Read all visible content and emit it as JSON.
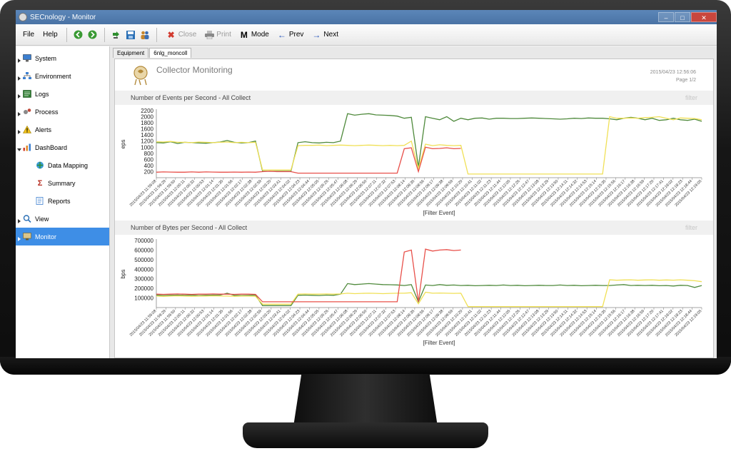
{
  "window": {
    "title": "SECnology - Monitor"
  },
  "menu": [
    {
      "label": "File"
    },
    {
      "label": "Help"
    }
  ],
  "toolbar": {
    "close_label": "Close",
    "print_label": "Print",
    "mode_label": "Mode",
    "prev_label": "Prev",
    "next_label": "Next"
  },
  "sidebar": {
    "items": [
      {
        "label": "System",
        "icon": "computer-icon"
      },
      {
        "label": "Environment",
        "icon": "network-icon"
      },
      {
        "label": "Logs",
        "icon": "logs-icon"
      },
      {
        "label": "Process",
        "icon": "process-icon"
      },
      {
        "label": "Alerts",
        "icon": "alert-icon"
      },
      {
        "label": "DashBoard",
        "icon": "dashboard-icon"
      },
      {
        "label": "Data Mapping",
        "icon": "data-mapping-icon"
      },
      {
        "label": "Summary",
        "icon": "sigma-icon"
      },
      {
        "label": "Reports",
        "icon": "reports-icon"
      },
      {
        "label": "View",
        "icon": "view-icon"
      },
      {
        "label": "Monitor",
        "icon": "monitor-icon"
      }
    ]
  },
  "tabs": [
    {
      "label": "Equipment"
    },
    {
      "label": "6nlg_moncoll"
    }
  ],
  "report": {
    "title": "Collector Monitoring",
    "date": "2015/04/23 12:56:06",
    "page": "Page 1/2"
  },
  "colors": {
    "green": "#4f8a3c",
    "yellow": "#f0e056",
    "red": "#e8504a",
    "accent": "#3e8ee6"
  },
  "chart_data": [
    {
      "type": "line",
      "title": "Number of Events per Second - All Collect",
      "filter_label": "filter",
      "ylabel": "eps",
      "xlabel": "[Filter Event]",
      "ylim": [
        0,
        2200
      ],
      "yticks": [
        200,
        400,
        600,
        800,
        1000,
        1200,
        1400,
        1600,
        1800,
        2000,
        2200
      ],
      "x": [
        "2015/04/23 11:59:08",
        "2015/04/23 11:59:29",
        "2015/04/23 11:59:50",
        "2015/04/23 12:00:11",
        "2015/04/23 12:00:32",
        "2015/04/23 12:00:53",
        "2015/04/23 12:01:14",
        "2015/04/23 12:01:35",
        "2015/04/23 12:01:56",
        "2015/04/23 12:02:17",
        "2015/04/23 12:02:38",
        "2015/04/23 12:02:59",
        "2015/04/23 12:03:20",
        "2015/04/23 12:03:41",
        "2015/04/23 12:04:02",
        "2015/04/23 12:04:23",
        "2015/04/23 12:04:44",
        "2015/04/23 12:05:05",
        "2015/04/23 12:05:26",
        "2015/04/23 12:05:47",
        "2015/04/23 12:06:08",
        "2015/04/23 12:06:29",
        "2015/04/23 12:06:50",
        "2015/04/23 12:07:11",
        "2015/04/23 12:07:32",
        "2015/04/23 12:07:53",
        "2015/04/23 12:08:14",
        "2015/04/23 12:08:35",
        "2015/04/23 12:08:56",
        "2015/04/23 12:09:17",
        "2015/04/23 12:09:38",
        "2015/04/23 12:09:59",
        "2015/04/23 12:10:20",
        "2015/04/23 12:10:41",
        "2015/04/23 12:11:02",
        "2015/04/23 12:11:23",
        "2015/04/23 12:11:44",
        "2015/04/23 12:12:05",
        "2015/04/23 12:12:26",
        "2015/04/23 12:12:47",
        "2015/04/23 12:13:08",
        "2015/04/23 12:13:29",
        "2015/04/23 12:13:50",
        "2015/04/23 12:14:11",
        "2015/04/23 12:14:32",
        "2015/04/23 12:14:53",
        "2015/04/23 12:15:14",
        "2015/04/23 12:15:35",
        "2015/04/23 12:15:56",
        "2015/04/23 12:16:17",
        "2015/04/23 12:16:38",
        "2015/04/23 12:16:59",
        "2015/04/23 12:17:20",
        "2015/04/23 12:17:41",
        "2015/04/23 12:18:02",
        "2015/04/23 12:18:23",
        "2015/04/23 12:18:44",
        "2015/04/23 12:19:05"
      ],
      "series": [
        {
          "color": "#4f8a3c",
          "values": [
            1150,
            1140,
            1180,
            1120,
            1160,
            1150,
            1140,
            1130,
            1150,
            1170,
            1220,
            1160,
            1140,
            1150,
            1200,
            210,
            210,
            210,
            210,
            210,
            1150,
            1180,
            1150,
            1140,
            1160,
            1150,
            1200,
            2100,
            2050,
            2080,
            2100,
            2060,
            2050,
            2040,
            2020,
            1950,
            1980,
            350,
            2000,
            1950,
            1900,
            2000,
            1850,
            1950,
            1900,
            1950,
            1960,
            1920,
            1950,
            1950,
            1940,
            1940,
            1950,
            1960,
            1950,
            1940,
            1930,
            1920,
            1930,
            1950,
            1940,
            1960,
            1950,
            1950,
            1930,
            1900,
            1950,
            1980,
            1950,
            1900,
            1950,
            1880,
            1900,
            1950,
            1900,
            1880,
            1920,
            1850
          ]
        },
        {
          "color": "#f0e056",
          "values": [
            1180,
            1170,
            1190,
            1160,
            1160,
            1150,
            1170,
            1160,
            1150,
            1160,
            1170,
            1150,
            1160,
            1150,
            1160,
            250,
            250,
            250,
            250,
            250,
            1050,
            1060,
            1060,
            1070,
            1050,
            1060,
            1070,
            1060,
            1050,
            1060,
            1070,
            1060,
            1050,
            1060,
            1050,
            1060,
            1200,
            300,
            1100,
            1050,
            1080,
            1060,
            1050,
            1060,
            120,
            120,
            120,
            120,
            120,
            120,
            120,
            120,
            120,
            120,
            120,
            120,
            120,
            120,
            120,
            120,
            120,
            120,
            120,
            120,
            2000,
            1950,
            1950,
            1960,
            1950,
            1970,
            1980,
            2000,
            1950,
            1900,
            1960,
            1950,
            1940,
            1900
          ]
        },
        {
          "color": "#e8504a",
          "values": [
            180,
            190,
            185,
            180,
            180,
            190,
            180,
            190,
            185,
            180,
            180,
            185,
            180,
            185,
            180,
            200,
            210,
            200,
            200,
            200,
            150,
            150,
            150,
            150,
            150,
            150,
            150,
            150,
            150,
            150,
            150,
            150,
            150,
            150,
            150,
            950,
            980,
            200,
            1000,
            950,
            960,
            980,
            950,
            960,
            null,
            null,
            null,
            null,
            null,
            null,
            null,
            null,
            null,
            null,
            null,
            null,
            null,
            null,
            null,
            null,
            null,
            null,
            null,
            null,
            null,
            null,
            null,
            null,
            null,
            null,
            null,
            null,
            null,
            null,
            null,
            null,
            null,
            null
          ]
        }
      ]
    },
    {
      "type": "line",
      "title": "Number of Bytes per Second - All Collect",
      "filter_label": "filter",
      "ylabel": "bps",
      "xlabel": "[Filter Event]",
      "ylim": [
        0,
        700000
      ],
      "yticks": [
        100000,
        200000,
        300000,
        400000,
        500000,
        600000,
        700000
      ],
      "x": [
        "2015/04/23 11:59:08",
        "2015/04/23 11:59:29",
        "2015/04/23 11:59:50",
        "2015/04/23 12:00:11",
        "2015/04/23 12:00:32",
        "2015/04/23 12:00:53",
        "2015/04/23 12:01:14",
        "2015/04/23 12:01:35",
        "2015/04/23 12:01:56",
        "2015/04/23 12:02:17",
        "2015/04/23 12:02:38",
        "2015/04/23 12:02:59",
        "2015/04/23 12:03:20",
        "2015/04/23 12:03:41",
        "2015/04/23 12:04:02",
        "2015/04/23 12:04:23",
        "2015/04/23 12:04:44",
        "2015/04/23 12:05:05",
        "2015/04/23 12:05:26",
        "2015/04/23 12:05:47",
        "2015/04/23 12:06:08",
        "2015/04/23 12:06:29",
        "2015/04/23 12:06:50",
        "2015/04/23 12:07:11",
        "2015/04/23 12:07:32",
        "2015/04/23 12:07:53",
        "2015/04/23 12:08:14",
        "2015/04/23 12:08:35",
        "2015/04/23 12:08:56",
        "2015/04/23 12:09:17",
        "2015/04/23 12:09:38",
        "2015/04/23 12:09:59",
        "2015/04/23 12:10:20",
        "2015/04/23 12:10:41",
        "2015/04/23 12:11:02",
        "2015/04/23 12:11:23",
        "2015/04/23 12:11:44",
        "2015/04/23 12:12:05",
        "2015/04/23 12:12:26",
        "2015/04/23 12:12:47",
        "2015/04/23 12:13:08",
        "2015/04/23 12:13:29",
        "2015/04/23 12:13:50",
        "2015/04/23 12:14:11",
        "2015/04/23 12:14:32",
        "2015/04/23 12:14:53",
        "2015/04/23 12:15:14",
        "2015/04/23 12:15:35",
        "2015/04/23 12:15:56",
        "2015/04/23 12:16:17",
        "2015/04/23 12:16:38",
        "2015/04/23 12:16:59",
        "2015/04/23 12:17:20",
        "2015/04/23 12:17:41",
        "2015/04/23 12:18:02",
        "2015/04/23 12:18:23",
        "2015/04/23 12:18:44",
        "2015/04/23 12:19:05"
      ],
      "series": [
        {
          "color": "#4f8a3c",
          "values": [
            130000,
            125000,
            128000,
            130000,
            127000,
            130000,
            125000,
            128000,
            130000,
            130000,
            150000,
            128000,
            126000,
            127000,
            130000,
            20000,
            20000,
            20000,
            20000,
            20000,
            128000,
            130000,
            128000,
            126000,
            130000,
            128000,
            140000,
            250000,
            240000,
            245000,
            250000,
            245000,
            240000,
            238000,
            236000,
            230000,
            240000,
            60000,
            235000,
            230000,
            240000,
            232000,
            235000,
            230000,
            232000,
            228000,
            230000,
            232000,
            230000,
            235000,
            230000,
            232000,
            228000,
            230000,
            232000,
            230000,
            230000,
            235000,
            230000,
            232000,
            228000,
            230000,
            232000,
            230000,
            230000,
            235000,
            240000,
            230000,
            232000,
            230000,
            232000,
            228000,
            230000,
            225000,
            232000,
            230000,
            210000,
            230000
          ]
        },
        {
          "color": "#f0e056",
          "values": [
            120000,
            118000,
            120000,
            122000,
            120000,
            118000,
            120000,
            120000,
            122000,
            120000,
            120000,
            118000,
            120000,
            120000,
            118000,
            35000,
            35000,
            35000,
            35000,
            35000,
            140000,
            142000,
            140000,
            140000,
            142000,
            140000,
            142000,
            150000,
            145000,
            148000,
            150000,
            148000,
            145000,
            148000,
            150000,
            150000,
            155000,
            40000,
            160000,
            150000,
            152000,
            150000,
            148000,
            150000,
            10000,
            10000,
            10000,
            10000,
            10000,
            10000,
            10000,
            10000,
            10000,
            10000,
            10000,
            10000,
            10000,
            10000,
            10000,
            10000,
            10000,
            10000,
            10000,
            10000,
            290000,
            285000,
            288000,
            290000,
            285000,
            288000,
            290000,
            285000,
            288000,
            286000,
            290000,
            285000,
            280000,
            270000
          ]
        },
        {
          "color": "#e8504a",
          "values": [
            140000,
            138000,
            140000,
            142000,
            140000,
            138000,
            140000,
            140000,
            142000,
            140000,
            140000,
            138000,
            140000,
            140000,
            138000,
            60000,
            60000,
            60000,
            60000,
            60000,
            60000,
            60000,
            60000,
            60000,
            60000,
            60000,
            60000,
            60000,
            60000,
            60000,
            60000,
            60000,
            60000,
            60000,
            60000,
            580000,
            600000,
            60000,
            610000,
            590000,
            600000,
            605000,
            595000,
            600000,
            null,
            null,
            null,
            null,
            null,
            null,
            null,
            null,
            null,
            null,
            null,
            null,
            null,
            null,
            null,
            null,
            null,
            null,
            null,
            null,
            null,
            null,
            null,
            null,
            null,
            null,
            null,
            null,
            null,
            null,
            null,
            null,
            null,
            null
          ]
        }
      ]
    }
  ]
}
